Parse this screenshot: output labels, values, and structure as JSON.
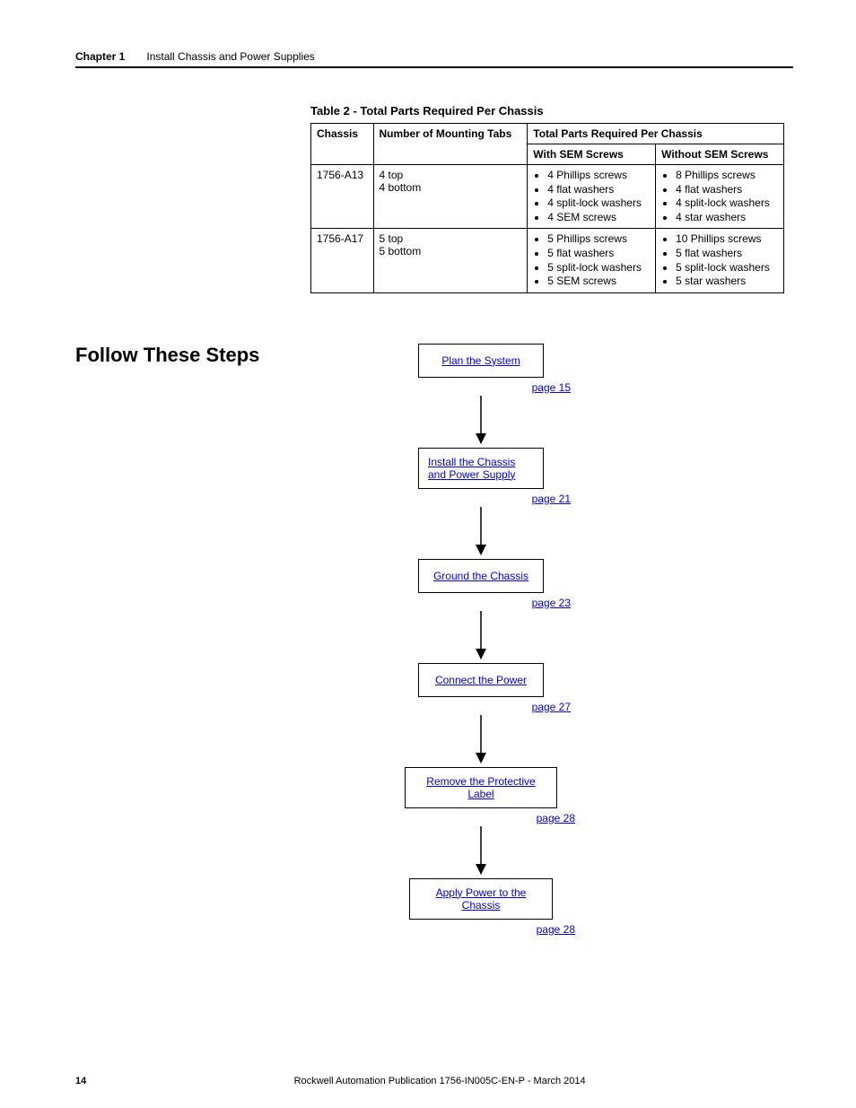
{
  "header": {
    "chapter_label": "Chapter 1",
    "chapter_title": "Install Chassis and Power Supplies"
  },
  "table": {
    "caption": "Table 2 - Total Parts Required Per Chassis",
    "col_chassis": "Chassis",
    "col_tabs": "Number of Mounting Tabs",
    "col_total_span": "Total Parts Required Per Chassis",
    "col_with": "With SEM Screws",
    "col_without": "Without SEM Screws",
    "rows": [
      {
        "chassis": "1756-A13",
        "tabs_top": "4 top",
        "tabs_bottom": "4 bottom",
        "with": [
          "4 Phillips screws",
          "4 flat washers",
          "4 split-lock washers",
          "4 SEM screws"
        ],
        "without": [
          "8 Phillips screws",
          "4 flat washers",
          "4 split-lock washers",
          "4 star washers"
        ]
      },
      {
        "chassis": "1756-A17",
        "tabs_top": "5 top",
        "tabs_bottom": "5 bottom",
        "with": [
          "5 Phillips screws",
          "5 flat washers",
          "5 split-lock washers",
          "5 SEM screws"
        ],
        "without": [
          "10 Phillips screws",
          "5 flat washers",
          "5 split-lock washers",
          "5 star washers"
        ]
      }
    ]
  },
  "section_heading": "Follow These Steps",
  "flow": [
    {
      "label": "Plan the System",
      "page": "page 15"
    },
    {
      "label": "Install the Chassis and Power Supply",
      "page": "page 21"
    },
    {
      "label": "Ground the Chassis",
      "page": "page 23"
    },
    {
      "label": "Connect the Power",
      "page": "page 27"
    },
    {
      "label": "Remove the Protective Label",
      "page": "page 28"
    },
    {
      "label": "Apply Power to the Chassis",
      "page": "page 28"
    }
  ],
  "footer": {
    "page_number": "14",
    "publication": "Rockwell Automation Publication 1756-IN005C-EN-P - March 2014"
  }
}
